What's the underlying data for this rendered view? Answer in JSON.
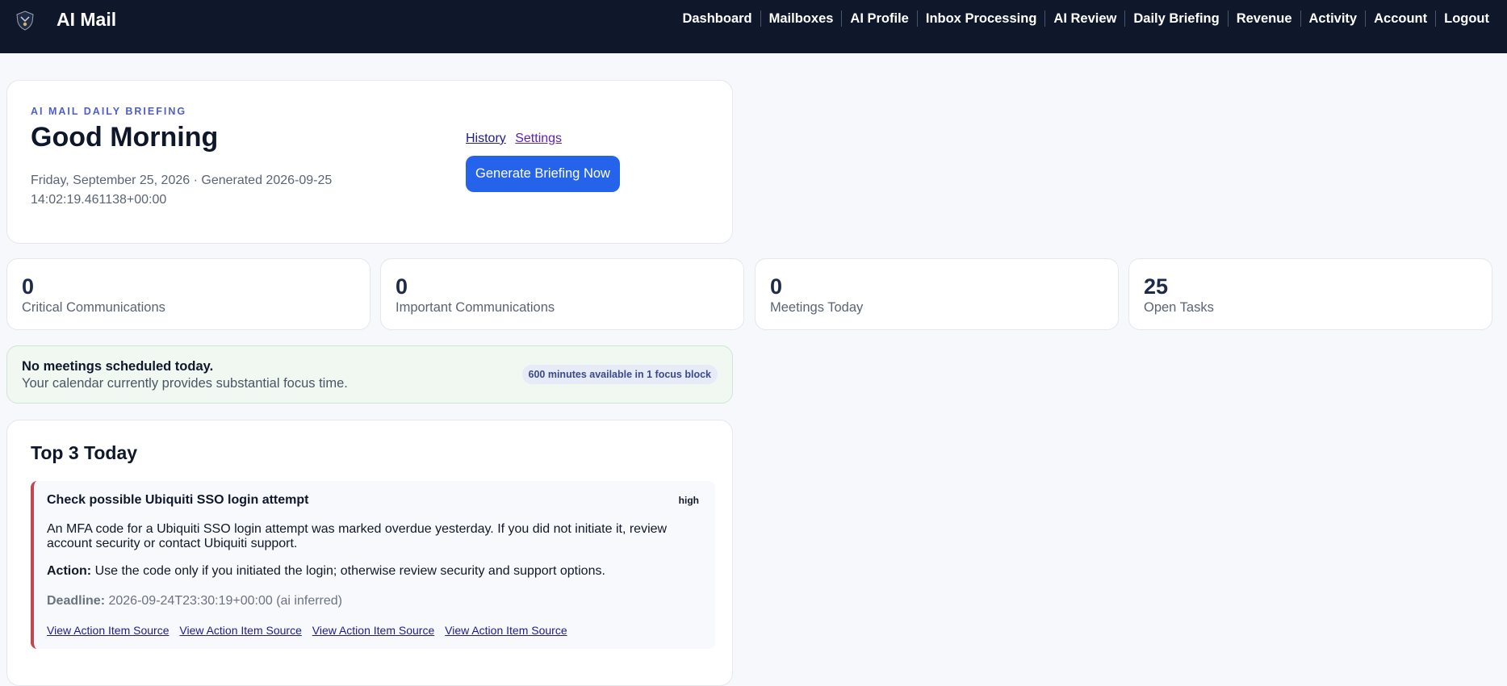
{
  "header": {
    "app_title": "AI Mail",
    "logo_icon": "shield-crest-icon",
    "nav": [
      {
        "label": "Dashboard"
      },
      {
        "label": "Mailboxes"
      },
      {
        "label": "AI Profile"
      },
      {
        "label": "Inbox Processing"
      },
      {
        "label": "AI Review"
      },
      {
        "label": "Daily Briefing"
      },
      {
        "label": "Revenue"
      },
      {
        "label": "Activity"
      },
      {
        "label": "Account"
      },
      {
        "label": "Logout"
      }
    ]
  },
  "hero": {
    "eyebrow": "AI MAIL DAILY BRIEFING",
    "greeting": "Good Morning",
    "generated_line": "Friday, September 25, 2026 · Generated 2026-09-25 14:02:19.461138+00:00",
    "history_link": "History",
    "settings_link": "Settings",
    "generate_button": "Generate Briefing Now"
  },
  "stats": [
    {
      "value": "0",
      "label": "Critical Communications"
    },
    {
      "value": "0",
      "label": "Important Communications"
    },
    {
      "value": "0",
      "label": "Meetings Today"
    },
    {
      "value": "25",
      "label": "Open Tasks"
    }
  ],
  "focus": {
    "title": "No meetings scheduled today.",
    "subtitle": "Your calendar currently provides substantial focus time.",
    "pill": "600 minutes available in 1 focus block"
  },
  "top3": {
    "title": "Top 3 Today",
    "items": [
      {
        "title": "Check possible Ubiquiti SSO login attempt",
        "priority": "high",
        "description": "An MFA code for a Ubiquiti SSO login attempt was marked overdue yesterday. If you did not initiate it, review account security or contact Ubiquiti support.",
        "action_label": "Action:",
        "action_text": "Use the code only if you initiated the login; otherwise review security and support options.",
        "deadline_label": "Deadline:",
        "deadline_text": "2026-09-24T23:30:19+00:00 (ai inferred)",
        "source_links": [
          "View Action Item Source",
          "View Action Item Source",
          "View Action Item Source",
          "View Action Item Source"
        ]
      }
    ]
  },
  "colors": {
    "topbar": "#0f172a",
    "accent": "#2563eb",
    "priority_high": "#c0464f",
    "focus_bg": "#f0f8f1"
  }
}
